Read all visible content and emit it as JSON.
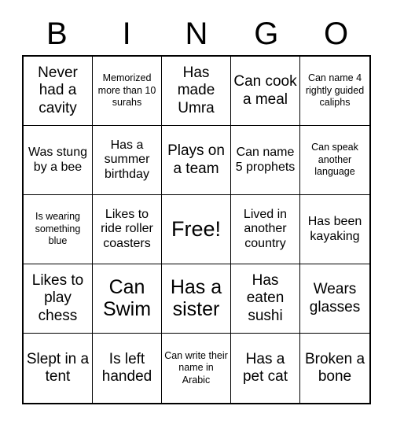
{
  "card": {
    "header_letters": [
      "B",
      "I",
      "N",
      "G",
      "O"
    ],
    "colors": {
      "background": "#ffffff",
      "text": "#000000",
      "grid_line": "#000000"
    },
    "grid_size": "5x5",
    "free_space_index": 12,
    "cells": [
      {
        "text": "Never had a cavity",
        "size": "md"
      },
      {
        "text": "Memorized more than 10 surahs",
        "size": "xs"
      },
      {
        "text": "Has made Umra",
        "size": "md"
      },
      {
        "text": "Can cook a meal",
        "size": "md"
      },
      {
        "text": "Can name 4 rightly guided caliphs",
        "size": "xs"
      },
      {
        "text": "Was stung by a bee",
        "size": "sm"
      },
      {
        "text": "Has a summer birthday",
        "size": "sm"
      },
      {
        "text": "Plays on a team",
        "size": "md"
      },
      {
        "text": "Can name 5 prophets",
        "size": "sm"
      },
      {
        "text": "Can speak another language",
        "size": "xs"
      },
      {
        "text": "Is wearing something blue",
        "size": "xs"
      },
      {
        "text": "Likes to ride roller coasters",
        "size": "sm"
      },
      {
        "text": "Free!",
        "size": "xl"
      },
      {
        "text": "Lived in another country",
        "size": "sm"
      },
      {
        "text": "Has been kayaking",
        "size": "sm"
      },
      {
        "text": "Likes to play chess",
        "size": "md"
      },
      {
        "text": "Can Swim",
        "size": "lg"
      },
      {
        "text": "Has a sister",
        "size": "lg"
      },
      {
        "text": "Has eaten sushi",
        "size": "md"
      },
      {
        "text": "Wears glasses",
        "size": "md"
      },
      {
        "text": "Slept in a tent",
        "size": "md"
      },
      {
        "text": "Is left handed",
        "size": "md"
      },
      {
        "text": "Can write their name in Arabic",
        "size": "xs"
      },
      {
        "text": "Has a pet cat",
        "size": "md"
      },
      {
        "text": "Broken a bone",
        "size": "md"
      }
    ]
  }
}
